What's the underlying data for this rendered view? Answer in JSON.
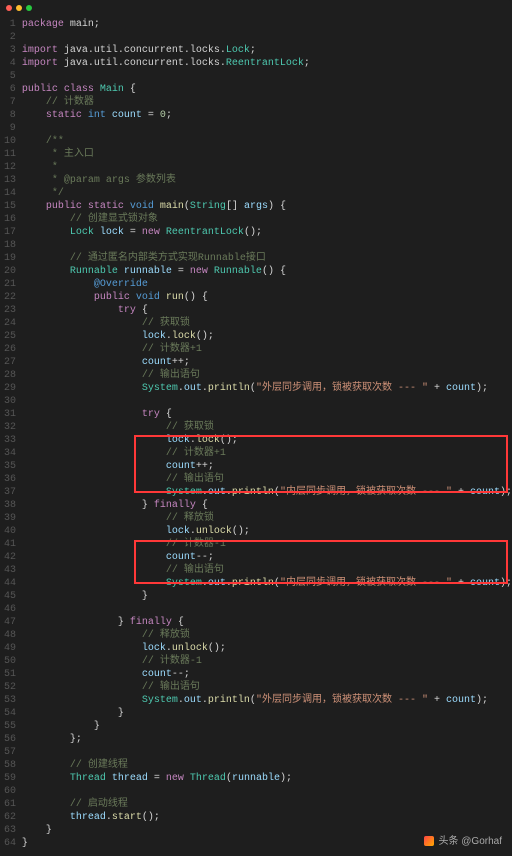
{
  "titlebar": {
    "dots": [
      "close",
      "min",
      "max"
    ]
  },
  "footer": {
    "prefix": "头条 ",
    "handle": "@Gorhaf"
  },
  "code": {
    "lines": [
      [
        [
          "kw",
          "package"
        ],
        [
          "op",
          " main;"
        ]
      ],
      [],
      [
        [
          "kw",
          "import"
        ],
        [
          "op",
          " java.util.concurrent.locks."
        ],
        [
          "cls",
          "Lock"
        ],
        [
          "op",
          ";"
        ]
      ],
      [
        [
          "kw",
          "import"
        ],
        [
          "op",
          " java.util.concurrent.locks."
        ],
        [
          "cls",
          "ReentrantLock"
        ],
        [
          "op",
          ";"
        ]
      ],
      [],
      [
        [
          "kw",
          "public class"
        ],
        [
          "op",
          " "
        ],
        [
          "cls",
          "Main"
        ],
        [
          "op",
          " {"
        ]
      ],
      [
        [
          "op",
          "    "
        ],
        [
          "cmt",
          "// 计数器"
        ]
      ],
      [
        [
          "op",
          "    "
        ],
        [
          "kw",
          "static"
        ],
        [
          "op",
          " "
        ],
        [
          "type",
          "int"
        ],
        [
          "op",
          " "
        ],
        [
          "var",
          "count"
        ],
        [
          "op",
          " = "
        ],
        [
          "num",
          "0"
        ],
        [
          "op",
          ";"
        ]
      ],
      [],
      [
        [
          "op",
          "    "
        ],
        [
          "cmt",
          "/**"
        ]
      ],
      [
        [
          "op",
          "    "
        ],
        [
          "cmt",
          " * 主入口"
        ]
      ],
      [
        [
          "op",
          "    "
        ],
        [
          "cmt",
          " *"
        ]
      ],
      [
        [
          "op",
          "    "
        ],
        [
          "cmt",
          " * @param args 参数列表"
        ]
      ],
      [
        [
          "op",
          "    "
        ],
        [
          "cmt",
          " */"
        ]
      ],
      [
        [
          "op",
          "    "
        ],
        [
          "kw",
          "public static"
        ],
        [
          "op",
          " "
        ],
        [
          "type",
          "void"
        ],
        [
          "op",
          " "
        ],
        [
          "fn",
          "main"
        ],
        [
          "op",
          "("
        ],
        [
          "cls",
          "String"
        ],
        [
          "op",
          "[] "
        ],
        [
          "var",
          "args"
        ],
        [
          "op",
          ") {"
        ]
      ],
      [
        [
          "op",
          "        "
        ],
        [
          "cmt",
          "// 创建显式锁对象"
        ]
      ],
      [
        [
          "op",
          "        "
        ],
        [
          "cls",
          "Lock"
        ],
        [
          "op",
          " "
        ],
        [
          "var",
          "lock"
        ],
        [
          "op",
          " = "
        ],
        [
          "kw",
          "new"
        ],
        [
          "op",
          " "
        ],
        [
          "cls",
          "ReentrantLock"
        ],
        [
          "op",
          "();"
        ]
      ],
      [],
      [
        [
          "op",
          "        "
        ],
        [
          "cmt",
          "// 通过匿名内部类方式实现Runnable接口"
        ]
      ],
      [
        [
          "op",
          "        "
        ],
        [
          "cls",
          "Runnable"
        ],
        [
          "op",
          " "
        ],
        [
          "var",
          "runnable"
        ],
        [
          "op",
          " = "
        ],
        [
          "kw",
          "new"
        ],
        [
          "op",
          " "
        ],
        [
          "cls",
          "Runnable"
        ],
        [
          "op",
          "() {"
        ]
      ],
      [
        [
          "op",
          "            "
        ],
        [
          "at",
          "@Override"
        ]
      ],
      [
        [
          "op",
          "            "
        ],
        [
          "kw",
          "public"
        ],
        [
          "op",
          " "
        ],
        [
          "type",
          "void"
        ],
        [
          "op",
          " "
        ],
        [
          "fn",
          "run"
        ],
        [
          "op",
          "() {"
        ]
      ],
      [
        [
          "op",
          "                "
        ],
        [
          "kw",
          "try"
        ],
        [
          "op",
          " {"
        ]
      ],
      [
        [
          "op",
          "                    "
        ],
        [
          "cmt",
          "// 获取锁"
        ]
      ],
      [
        [
          "op",
          "                    "
        ],
        [
          "var",
          "lock"
        ],
        [
          "op",
          "."
        ],
        [
          "fn",
          "lock"
        ],
        [
          "op",
          "();"
        ]
      ],
      [
        [
          "op",
          "                    "
        ],
        [
          "cmt",
          "// 计数器+1"
        ]
      ],
      [
        [
          "op",
          "                    "
        ],
        [
          "var",
          "count"
        ],
        [
          "op",
          "++;"
        ]
      ],
      [
        [
          "op",
          "                    "
        ],
        [
          "cmt",
          "// 输出语句"
        ]
      ],
      [
        [
          "op",
          "                    "
        ],
        [
          "cls",
          "System"
        ],
        [
          "op",
          "."
        ],
        [
          "var",
          "out"
        ],
        [
          "op",
          "."
        ],
        [
          "fn",
          "println"
        ],
        [
          "op",
          "("
        ],
        [
          "str",
          "\"外层同步调用，锁被获取次数 --- \""
        ],
        [
          "op",
          " + "
        ],
        [
          "var",
          "count"
        ],
        [
          "op",
          ");"
        ]
      ],
      [],
      [
        [
          "op",
          "                    "
        ],
        [
          "kw",
          "try"
        ],
        [
          "op",
          " {"
        ]
      ],
      [
        [
          "op",
          "                        "
        ],
        [
          "cmt",
          "// 获取锁"
        ]
      ],
      [
        [
          "op",
          "                        "
        ],
        [
          "var",
          "lock"
        ],
        [
          "op",
          "."
        ],
        [
          "fn",
          "lock"
        ],
        [
          "op",
          "();"
        ]
      ],
      [
        [
          "op",
          "                        "
        ],
        [
          "cmt",
          "// 计数器+1"
        ]
      ],
      [
        [
          "op",
          "                        "
        ],
        [
          "var",
          "count"
        ],
        [
          "op",
          "++;"
        ]
      ],
      [
        [
          "op",
          "                        "
        ],
        [
          "cmt",
          "// 输出语句"
        ]
      ],
      [
        [
          "op",
          "                        "
        ],
        [
          "cls",
          "System"
        ],
        [
          "op",
          "."
        ],
        [
          "var",
          "out"
        ],
        [
          "op",
          "."
        ],
        [
          "fn",
          "println"
        ],
        [
          "op",
          "("
        ],
        [
          "str",
          "\"内层同步调用，锁被获取次数 --- \""
        ],
        [
          "op",
          " + "
        ],
        [
          "var",
          "count"
        ],
        [
          "op",
          ");"
        ]
      ],
      [
        [
          "op",
          "                    } "
        ],
        [
          "kw",
          "finally"
        ],
        [
          "op",
          " {"
        ]
      ],
      [
        [
          "op",
          "                        "
        ],
        [
          "cmt",
          "// 释放锁"
        ]
      ],
      [
        [
          "op",
          "                        "
        ],
        [
          "var",
          "lock"
        ],
        [
          "op",
          "."
        ],
        [
          "fn",
          "unlock"
        ],
        [
          "op",
          "();"
        ]
      ],
      [
        [
          "op",
          "                        "
        ],
        [
          "cmt",
          "// 计数器-1"
        ]
      ],
      [
        [
          "op",
          "                        "
        ],
        [
          "var",
          "count"
        ],
        [
          "op",
          "--;"
        ]
      ],
      [
        [
          "op",
          "                        "
        ],
        [
          "cmt",
          "// 输出语句"
        ]
      ],
      [
        [
          "op",
          "                        "
        ],
        [
          "cls",
          "System"
        ],
        [
          "op",
          "."
        ],
        [
          "var",
          "out"
        ],
        [
          "op",
          "."
        ],
        [
          "fn",
          "println"
        ],
        [
          "op",
          "("
        ],
        [
          "str",
          "\"内层同步调用，锁被获取次数 --- \""
        ],
        [
          "op",
          " + "
        ],
        [
          "var",
          "count"
        ],
        [
          "op",
          ");"
        ]
      ],
      [
        [
          "op",
          "                    }"
        ]
      ],
      [],
      [
        [
          "op",
          "                } "
        ],
        [
          "kw",
          "finally"
        ],
        [
          "op",
          " {"
        ]
      ],
      [
        [
          "op",
          "                    "
        ],
        [
          "cmt",
          "// 释放锁"
        ]
      ],
      [
        [
          "op",
          "                    "
        ],
        [
          "var",
          "lock"
        ],
        [
          "op",
          "."
        ],
        [
          "fn",
          "unlock"
        ],
        [
          "op",
          "();"
        ]
      ],
      [
        [
          "op",
          "                    "
        ],
        [
          "cmt",
          "// 计数器-1"
        ]
      ],
      [
        [
          "op",
          "                    "
        ],
        [
          "var",
          "count"
        ],
        [
          "op",
          "--;"
        ]
      ],
      [
        [
          "op",
          "                    "
        ],
        [
          "cmt",
          "// 输出语句"
        ]
      ],
      [
        [
          "op",
          "                    "
        ],
        [
          "cls",
          "System"
        ],
        [
          "op",
          "."
        ],
        [
          "var",
          "out"
        ],
        [
          "op",
          "."
        ],
        [
          "fn",
          "println"
        ],
        [
          "op",
          "("
        ],
        [
          "str",
          "\"外层同步调用，锁被获取次数 --- \""
        ],
        [
          "op",
          " + "
        ],
        [
          "var",
          "count"
        ],
        [
          "op",
          ");"
        ]
      ],
      [
        [
          "op",
          "                }"
        ]
      ],
      [
        [
          "op",
          "            }"
        ]
      ],
      [
        [
          "op",
          "        };"
        ]
      ],
      [],
      [
        [
          "op",
          "        "
        ],
        [
          "cmt",
          "// 创建线程"
        ]
      ],
      [
        [
          "op",
          "        "
        ],
        [
          "cls",
          "Thread"
        ],
        [
          "op",
          " "
        ],
        [
          "var",
          "thread"
        ],
        [
          "op",
          " = "
        ],
        [
          "kw",
          "new"
        ],
        [
          "op",
          " "
        ],
        [
          "cls",
          "Thread"
        ],
        [
          "op",
          "("
        ],
        [
          "var",
          "runnable"
        ],
        [
          "op",
          ");"
        ]
      ],
      [],
      [
        [
          "op",
          "        "
        ],
        [
          "cmt",
          "// 启动线程"
        ]
      ],
      [
        [
          "op",
          "        "
        ],
        [
          "var",
          "thread"
        ],
        [
          "op",
          "."
        ],
        [
          "fn",
          "start"
        ],
        [
          "op",
          "();"
        ]
      ],
      [
        [
          "op",
          "    }"
        ]
      ],
      [
        [
          "op",
          "}"
        ]
      ]
    ]
  }
}
